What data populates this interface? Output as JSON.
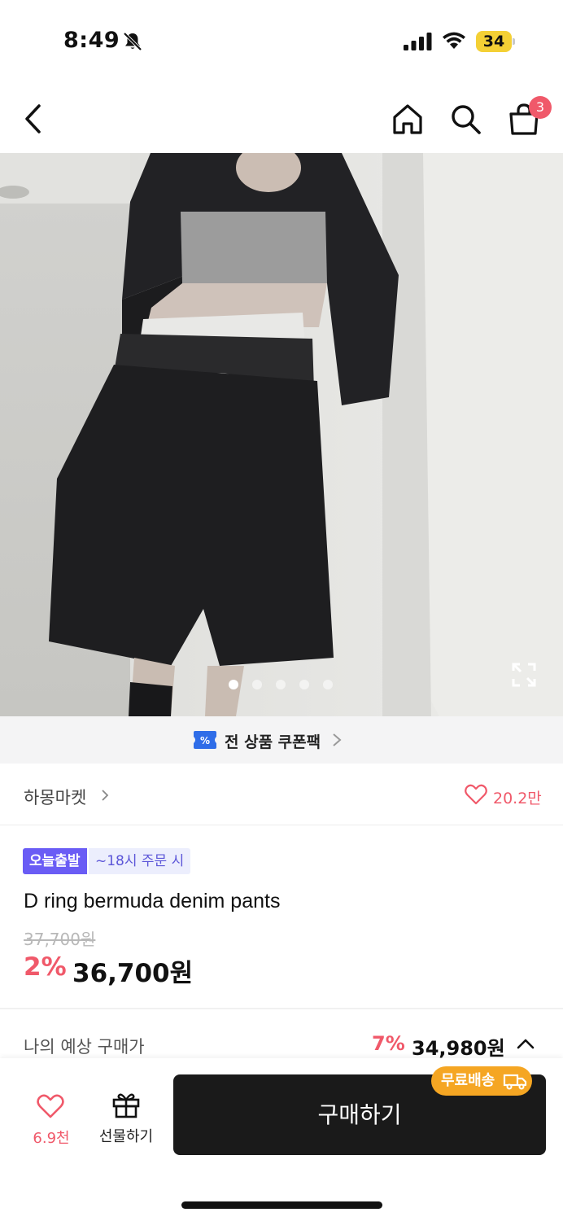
{
  "status_bar": {
    "time": "8:49",
    "battery": "34",
    "icons": [
      "bell-off-icon",
      "signal-icon",
      "wifi-icon",
      "battery-icon"
    ],
    "battery_color": "#f4d035"
  },
  "nav": {
    "icons": [
      "back-icon",
      "home-icon",
      "search-icon",
      "cart-icon"
    ],
    "cart_badge": "3"
  },
  "hero": {
    "gallery_total": 5,
    "gallery_active": 1,
    "icons": [
      "expand-icon"
    ]
  },
  "coupon": {
    "label": "전 상품 쿠폰팩"
  },
  "store": {
    "name": "하몽마켓",
    "likes": "20.2만"
  },
  "product": {
    "badge_today": "오늘출발",
    "badge_time": "~18시 주문 시",
    "title": "D ring bermuda denim pants",
    "original_price": "37,700원",
    "discount_rate": "2%",
    "sale_price": "36,700원"
  },
  "expected": {
    "label": "나의 예상 구매가",
    "rate": "7%",
    "price": "34,980원"
  },
  "bottom_bar": {
    "wish_count": "6.9천",
    "gift_label": "선물하기",
    "buy_label": "구매하기",
    "free_shipping": "무료배송"
  },
  "colors": {
    "accent": "#f0596a",
    "badge_purple": "#6a5cf5",
    "free_badge": "#f5a623",
    "buy_button": "#1a1a1a"
  }
}
